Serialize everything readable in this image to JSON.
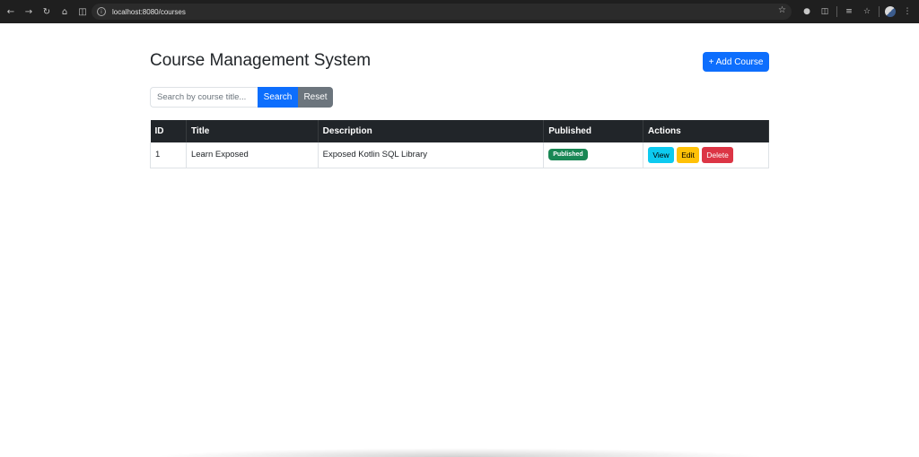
{
  "browser": {
    "url": "localhost:8080/courses",
    "icons": [
      "back-icon",
      "forward-icon",
      "reload-icon",
      "home-icon",
      "sidebar-icon",
      "site-info-icon",
      "bookmark-star-icon",
      "extension-icon",
      "puzzle-icon",
      "reader-icon",
      "bookmarks-icon",
      "profile-avatar",
      "menu-icon"
    ]
  },
  "page": {
    "title": "Course Management System",
    "add_button": "+ Add Course"
  },
  "search": {
    "placeholder": "Search by course title...",
    "value": "",
    "search_label": "Search",
    "reset_label": "Reset"
  },
  "table": {
    "headers": {
      "id": "ID",
      "title": "Title",
      "description": "Description",
      "published": "Published",
      "actions": "Actions"
    },
    "rows": [
      {
        "id": "1",
        "title": "Learn Exposed",
        "description": "Exposed Kotlin SQL Library",
        "published": "Published",
        "view": "View",
        "edit": "Edit",
        "delete": "Delete"
      }
    ]
  },
  "colors": {
    "primary": "#0d6efd",
    "secondary": "#6c757d",
    "success": "#198754",
    "info": "#0dcaf0",
    "warning": "#ffc107",
    "danger": "#dc3545",
    "dark": "#212529"
  }
}
